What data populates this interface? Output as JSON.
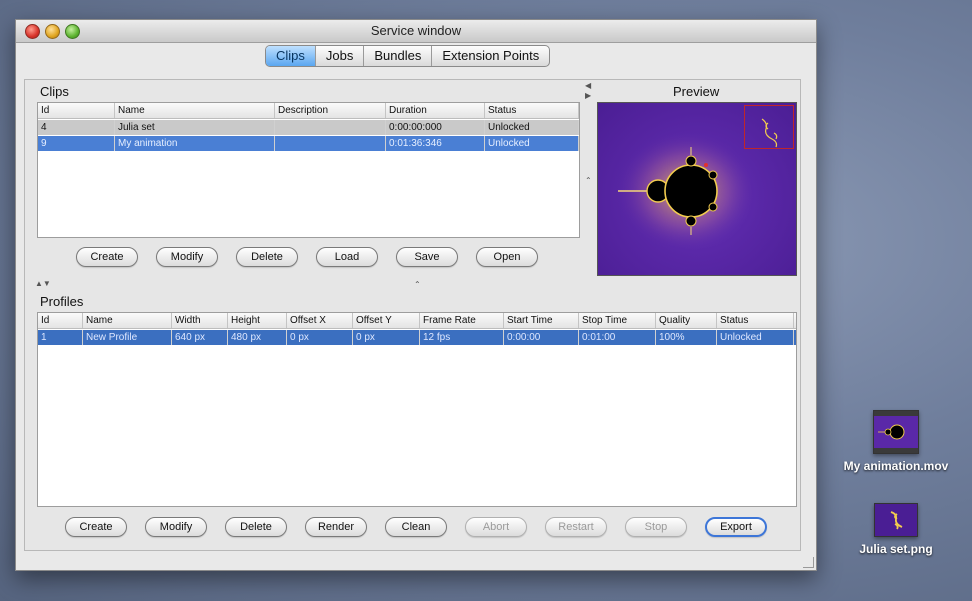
{
  "window": {
    "title": "Service window"
  },
  "tabs": [
    {
      "label": "Clips",
      "active": true
    },
    {
      "label": "Jobs",
      "active": false
    },
    {
      "label": "Bundles",
      "active": false
    },
    {
      "label": "Extension Points",
      "active": false
    }
  ],
  "clips": {
    "title": "Clips",
    "columns": [
      "Id",
      "Name",
      "Description",
      "Duration",
      "Status"
    ],
    "rows": [
      {
        "id": "4",
        "name": "Julia set",
        "description": "",
        "duration": "0:00:00:000",
        "status": "Unlocked"
      },
      {
        "id": "9",
        "name": "My animation",
        "description": "",
        "duration": "0:01:36:346",
        "status": "Unlocked"
      }
    ],
    "buttons": [
      "Create",
      "Modify",
      "Delete",
      "Load",
      "Save",
      "Open"
    ]
  },
  "preview": {
    "title": "Preview"
  },
  "profiles": {
    "title": "Profiles",
    "columns": [
      "Id",
      "Name",
      "Width",
      "Height",
      "Offset X",
      "Offset Y",
      "Frame Rate",
      "Start Time",
      "Stop Time",
      "Quality",
      "Status"
    ],
    "rows": [
      {
        "id": "1",
        "name": "New Profile",
        "width": "640 px",
        "height": "480 px",
        "offset_x": "0 px",
        "offset_y": "0 px",
        "frame_rate": "12 fps",
        "start_time": "0:00:00",
        "stop_time": "0:01:00",
        "quality": "100%",
        "status": "Unlocked"
      }
    ],
    "buttons": [
      {
        "label": "Create",
        "enabled": true
      },
      {
        "label": "Modify",
        "enabled": true
      },
      {
        "label": "Delete",
        "enabled": true
      },
      {
        "label": "Render",
        "enabled": true
      },
      {
        "label": "Clean",
        "enabled": true
      },
      {
        "label": "Abort",
        "enabled": false
      },
      {
        "label": "Restart",
        "enabled": false
      },
      {
        "label": "Stop",
        "enabled": false
      },
      {
        "label": "Export",
        "enabled": true,
        "default": true
      }
    ]
  },
  "desktop": {
    "files": [
      {
        "label": "My animation.mov",
        "icon": "movie-file-icon"
      },
      {
        "label": "Julia set.png",
        "icon": "image-file-icon"
      }
    ]
  },
  "colors": {
    "selection": "#4a7fd4",
    "fractal_bg": "#5a28a8",
    "default_button": "#3d76d8"
  }
}
